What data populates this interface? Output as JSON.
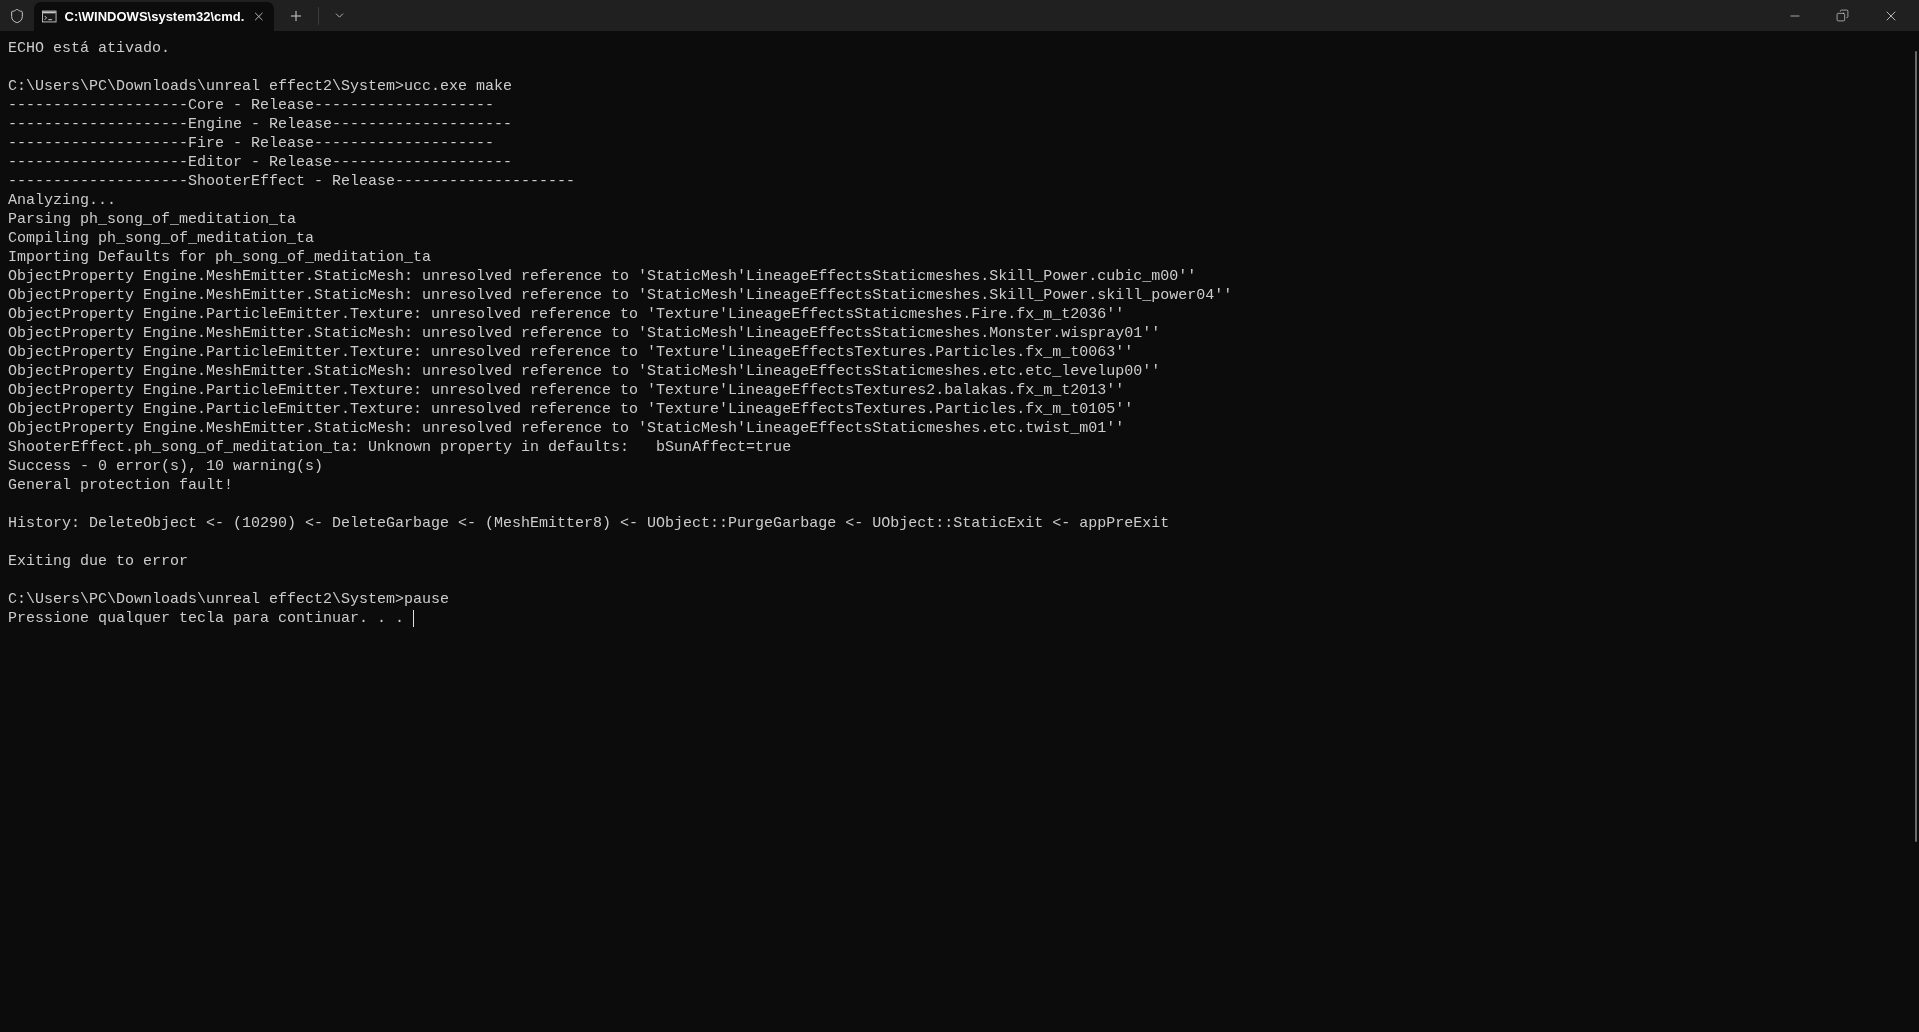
{
  "tab": {
    "title": "C:\\WINDOWS\\system32\\cmd.",
    "selected": true
  },
  "terminal": {
    "blocks": [
      [
        "ECHO está ativado."
      ],
      [
        "C:\\Users\\PC\\Downloads\\unreal effect2\\System>ucc.exe make",
        "--------------------Core - Release--------------------",
        "--------------------Engine - Release--------------------",
        "--------------------Fire - Release--------------------",
        "--------------------Editor - Release--------------------",
        "--------------------ShooterEffect - Release--------------------",
        "Analyzing...",
        "Parsing ph_song_of_meditation_ta",
        "Compiling ph_song_of_meditation_ta",
        "Importing Defaults for ph_song_of_meditation_ta",
        "ObjectProperty Engine.MeshEmitter.StaticMesh: unresolved reference to 'StaticMesh'LineageEffectsStaticmeshes.Skill_Power.cubic_m00''",
        "ObjectProperty Engine.MeshEmitter.StaticMesh: unresolved reference to 'StaticMesh'LineageEffectsStaticmeshes.Skill_Power.skill_power04''",
        "ObjectProperty Engine.ParticleEmitter.Texture: unresolved reference to 'Texture'LineageEffectsStaticmeshes.Fire.fx_m_t2036''",
        "ObjectProperty Engine.MeshEmitter.StaticMesh: unresolved reference to 'StaticMesh'LineageEffectsStaticmeshes.Monster.wispray01''",
        "ObjectProperty Engine.ParticleEmitter.Texture: unresolved reference to 'Texture'LineageEffectsTextures.Particles.fx_m_t0063''",
        "ObjectProperty Engine.MeshEmitter.StaticMesh: unresolved reference to 'StaticMesh'LineageEffectsStaticmeshes.etc.etc_levelup00''",
        "ObjectProperty Engine.ParticleEmitter.Texture: unresolved reference to 'Texture'LineageEffectsTextures2.balakas.fx_m_t2013''",
        "ObjectProperty Engine.ParticleEmitter.Texture: unresolved reference to 'Texture'LineageEffectsTextures.Particles.fx_m_t0105''",
        "ObjectProperty Engine.MeshEmitter.StaticMesh: unresolved reference to 'StaticMesh'LineageEffectsStaticmeshes.etc.twist_m01''",
        "ShooterEffect.ph_song_of_meditation_ta: Unknown property in defaults:   bSunAffect=true",
        "Success - 0 error(s), 10 warning(s)",
        "General protection fault!"
      ],
      [
        "History: DeleteObject <- (10290) <- DeleteGarbage <- (MeshEmitter8) <- UObject::PurgeGarbage <- UObject::StaticExit <- appPreExit"
      ],
      [
        "Exiting due to error"
      ],
      [
        "C:\\Users\\PC\\Downloads\\unreal effect2\\System>pause",
        "Pressione qualquer tecla para continuar. . ."
      ]
    ],
    "cursor_visible": true
  }
}
